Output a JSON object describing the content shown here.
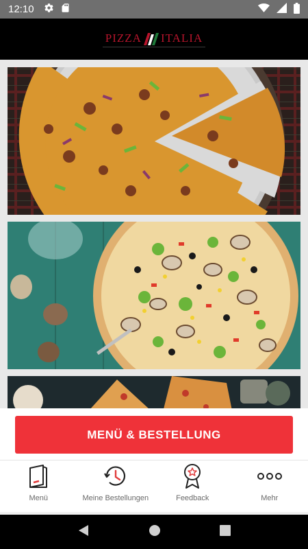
{
  "status_bar": {
    "time": "12:10",
    "left_icons": [
      "gear-icon",
      "sd-card-icon"
    ],
    "right_icons": [
      "wifi-icon",
      "signal-icon",
      "battery-icon"
    ]
  },
  "header": {
    "logo_text_left": "PIZZA",
    "logo_text_right": "ITALIA",
    "logo_colors": [
      "#b8152c",
      "#1f7a3a",
      "#ffffff"
    ]
  },
  "cards": [
    {
      "image": "pizza-image-sliced"
    },
    {
      "image": "pizza-image-vegetable"
    },
    {
      "image": "pizza-image-table"
    }
  ],
  "order_button": {
    "label": "MENÜ & BESTELLUNG",
    "color": "#ef3239"
  },
  "bottom_nav": {
    "items": [
      {
        "label": "Menü",
        "icon": "menu-card-icon"
      },
      {
        "label": "Meine Bestellungen",
        "icon": "history-clock-icon"
      },
      {
        "label": "Feedback",
        "icon": "award-star-icon"
      },
      {
        "label": "Mehr",
        "icon": "more-dots-icon"
      }
    ]
  },
  "android_nav": {
    "buttons": [
      "back-icon",
      "home-icon",
      "recents-icon"
    ]
  }
}
